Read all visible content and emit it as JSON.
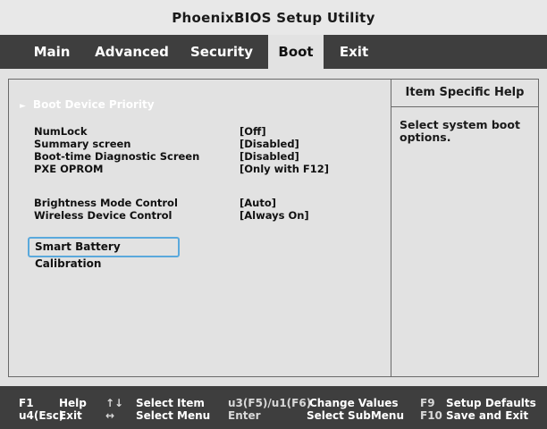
{
  "title": "PhoenixBIOS Setup Utility",
  "menu": [
    {
      "label": "Main"
    },
    {
      "label": "Advanced"
    },
    {
      "label": "Security"
    },
    {
      "label": "Boot"
    },
    {
      "label": "Exit"
    }
  ],
  "active_menu": "Boot",
  "boot_device_priority": "Boot Device Priority",
  "settings": [
    {
      "label": "NumLock",
      "value": "[Off]"
    },
    {
      "label": "Summary screen",
      "value": "[Disabled]"
    },
    {
      "label": "Boot-time Diagnostic Screen",
      "value": "[Disabled]"
    },
    {
      "label": "PXE OPROM",
      "value": "[Only with F12]"
    },
    {
      "label": "Brightness Mode Control",
      "value": "[Auto]"
    },
    {
      "label": "Wireless Device Control",
      "value": "[Always On]"
    }
  ],
  "selected_item": "Smart Battery Calibration",
  "help": {
    "title": "Item Specific Help",
    "text": "Select system boot options."
  },
  "footer": {
    "f1_key": "F1",
    "f1_label": "Help",
    "esc_key": "u4(Esc)",
    "esc_label": "Exit",
    "updown_key": "↑↓",
    "updown_label": "Select Item",
    "leftright_key": "↔",
    "leftright_label": "Select Menu",
    "change_key": "u3(F5)/u1(F6)",
    "change_label": "Change Values",
    "enter_key": "Enter",
    "enter_label": "Select SubMenu",
    "f9_key": "F9",
    "f9_label": "Setup Defaults",
    "f10_key": "F10",
    "f10_label": "Save and Exit"
  }
}
